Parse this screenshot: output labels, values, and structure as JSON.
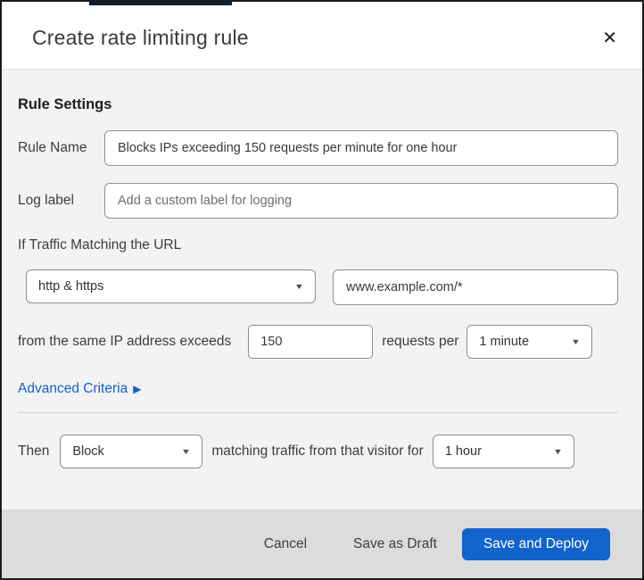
{
  "modal": {
    "title": "Create rate limiting rule"
  },
  "icons": {
    "close": "✕",
    "chevron_down": "▼",
    "arrow_right": "▶"
  },
  "colors": {
    "primary_button_blue": "#1264cc",
    "link_blue": "#0e63c8",
    "body_background": "#f3f3f4",
    "footer_background": "#dcdcdc",
    "page_strip_navy": "#0a2132"
  },
  "form": {
    "section_heading": "Rule Settings",
    "rule_name": {
      "label": "Rule Name",
      "value": "Blocks IPs exceeding 150 requests per minute for one hour"
    },
    "log_label": {
      "label": "Log label",
      "placeholder": "Add a custom label for logging"
    },
    "traffic_match": {
      "heading": "If Traffic Matching the URL",
      "scheme_selected": "http & https",
      "url_value": "www.example.com/*",
      "threshold_prefix": "from the same IP address exceeds",
      "requests_value": "150",
      "threshold_middle": "requests per",
      "period_selected": "1 minute"
    },
    "advanced_link_label": "Advanced Criteria",
    "then_clause": {
      "label": "Then",
      "action_selected": "Block",
      "middle": "matching traffic from that visitor for",
      "duration_selected": "1 hour"
    }
  },
  "footer": {
    "cancel_label": "Cancel",
    "save_draft_label": "Save as Draft",
    "save_deploy_label": "Save and Deploy"
  }
}
